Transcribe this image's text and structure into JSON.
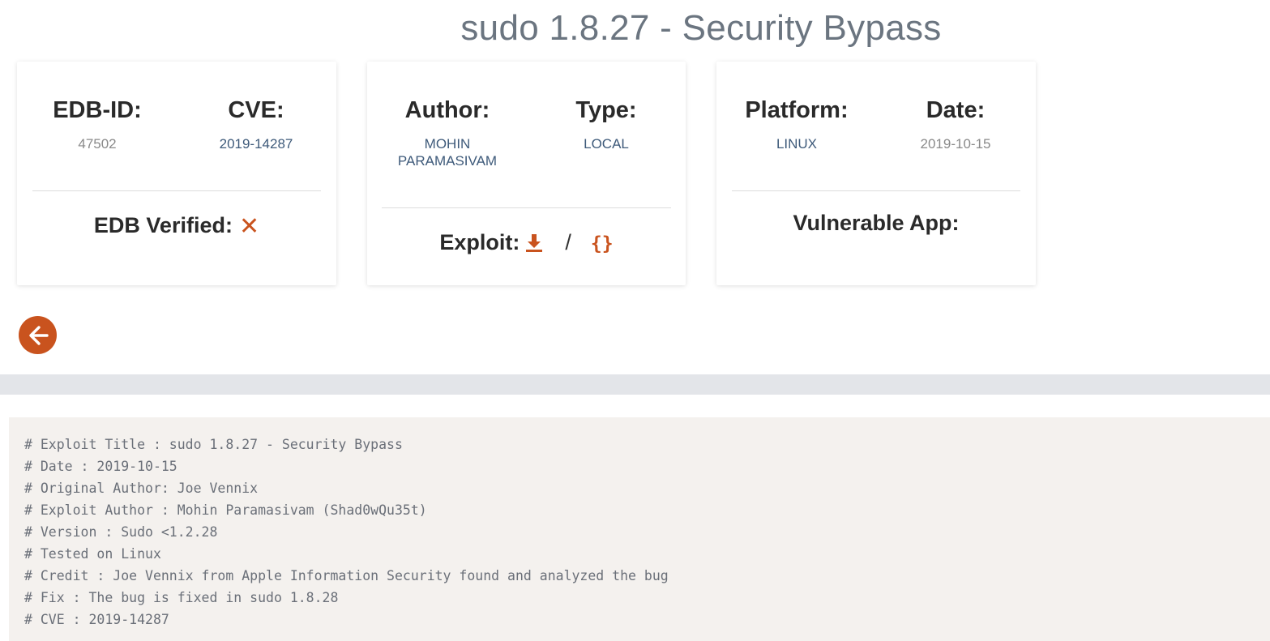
{
  "page": {
    "title": "sudo 1.8.27 - Security Bypass"
  },
  "card1": {
    "edb_id_label": "EDB-ID:",
    "edb_id_value": "47502",
    "cve_label": "CVE:",
    "cve_value": "2019-14287",
    "verified_label": "EDB Verified:",
    "verified_icon": "x-icon"
  },
  "card2": {
    "author_label": "Author:",
    "author_value": "MOHIN PARAMASIVAM",
    "type_label": "Type:",
    "type_value": "LOCAL",
    "exploit_label": "Exploit:",
    "separator": "/",
    "raw_icon_text": "{}"
  },
  "card3": {
    "platform_label": "Platform:",
    "platform_value": "LINUX",
    "date_label": "Date:",
    "date_value": "2019-10-15",
    "vuln_app_label": "Vulnerable App:"
  },
  "colors": {
    "accent": "#c9531e",
    "link_blue": "#3e5a7a",
    "muted": "#8a8a8a",
    "code_bg": "#f4f1ee",
    "band": "#e3e5e9"
  },
  "code": {
    "lines": [
      "# Exploit Title : sudo 1.8.27 - Security Bypass",
      "# Date : 2019-10-15",
      "# Original Author: Joe Vennix",
      "# Exploit Author : Mohin Paramasivam (Shad0wQu35t)",
      "# Version : Sudo <1.2.28",
      "# Tested on Linux",
      "# Credit : Joe Vennix from Apple Information Security found and analyzed the bug",
      "# Fix : The bug is fixed in sudo 1.8.28",
      "# CVE : 2019-14287"
    ]
  }
}
